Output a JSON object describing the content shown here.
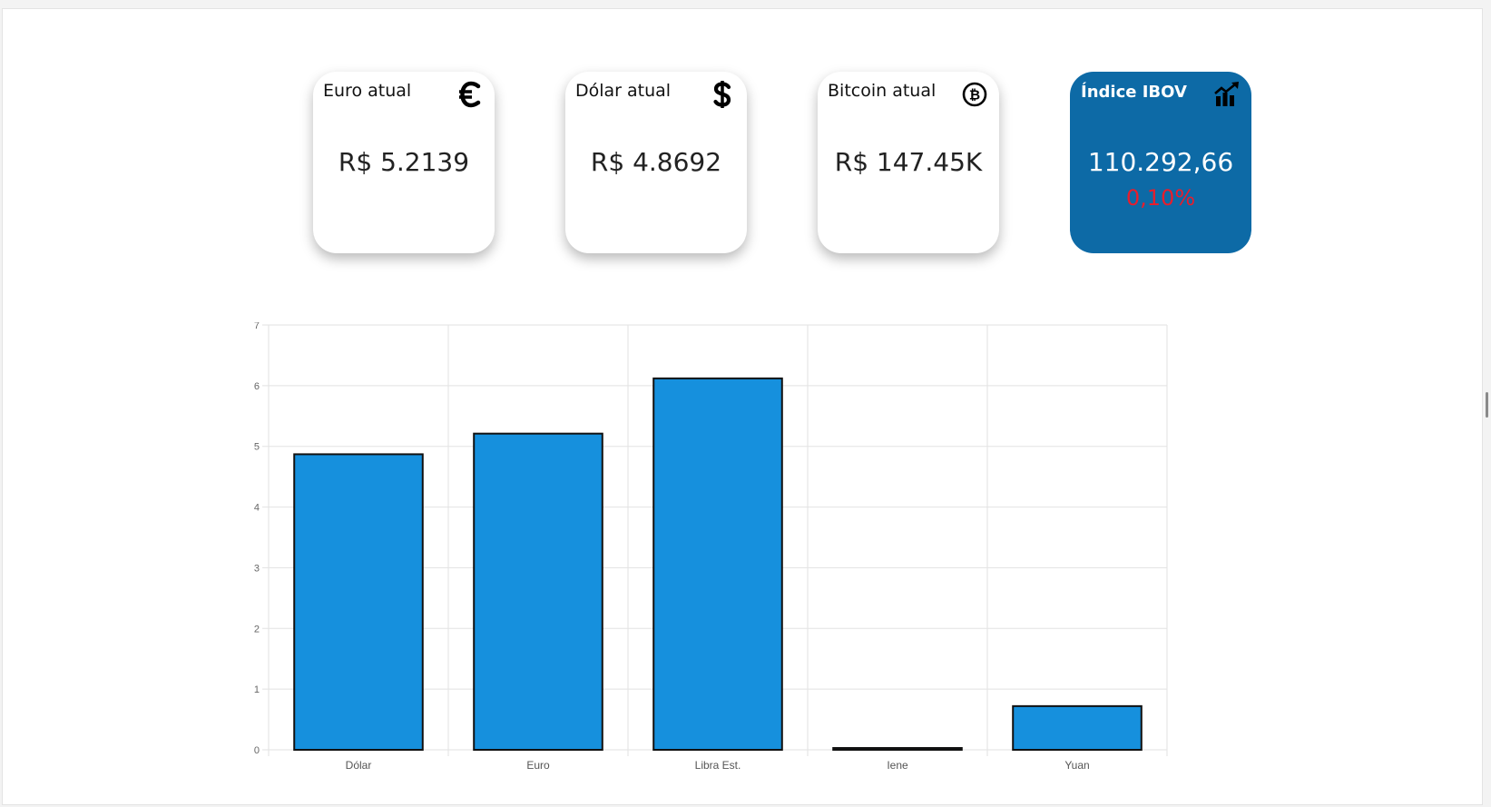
{
  "cards": [
    {
      "title": "Euro atual",
      "value": "R$ 5.2139",
      "icon": "euro-icon"
    },
    {
      "title": "Dólar atual",
      "value": "R$ 4.8692",
      "icon": "dollar-icon"
    },
    {
      "title": "Bitcoin atual",
      "value": "R$ 147.45K",
      "icon": "bitcoin-icon"
    },
    {
      "title": "Índice IBOV",
      "value": "110.292,66",
      "change": "0,10%",
      "icon": "chart-trend-icon"
    }
  ],
  "colors": {
    "ibov_card_bg": "#0d6aa6",
    "negative_change": "#e81d2c",
    "bar_fill": "#1690dd",
    "bar_stroke": "#111111"
  },
  "chart_data": {
    "type": "bar",
    "categories": [
      "Dólar",
      "Euro",
      "Libra Est.",
      "Iene",
      "Yuan"
    ],
    "values": [
      4.87,
      5.21,
      6.12,
      0.03,
      0.72
    ],
    "ylim": [
      0,
      7
    ],
    "yticks": [
      0,
      1,
      2,
      3,
      4,
      5,
      6,
      7
    ],
    "grid": true,
    "legend": "none"
  }
}
